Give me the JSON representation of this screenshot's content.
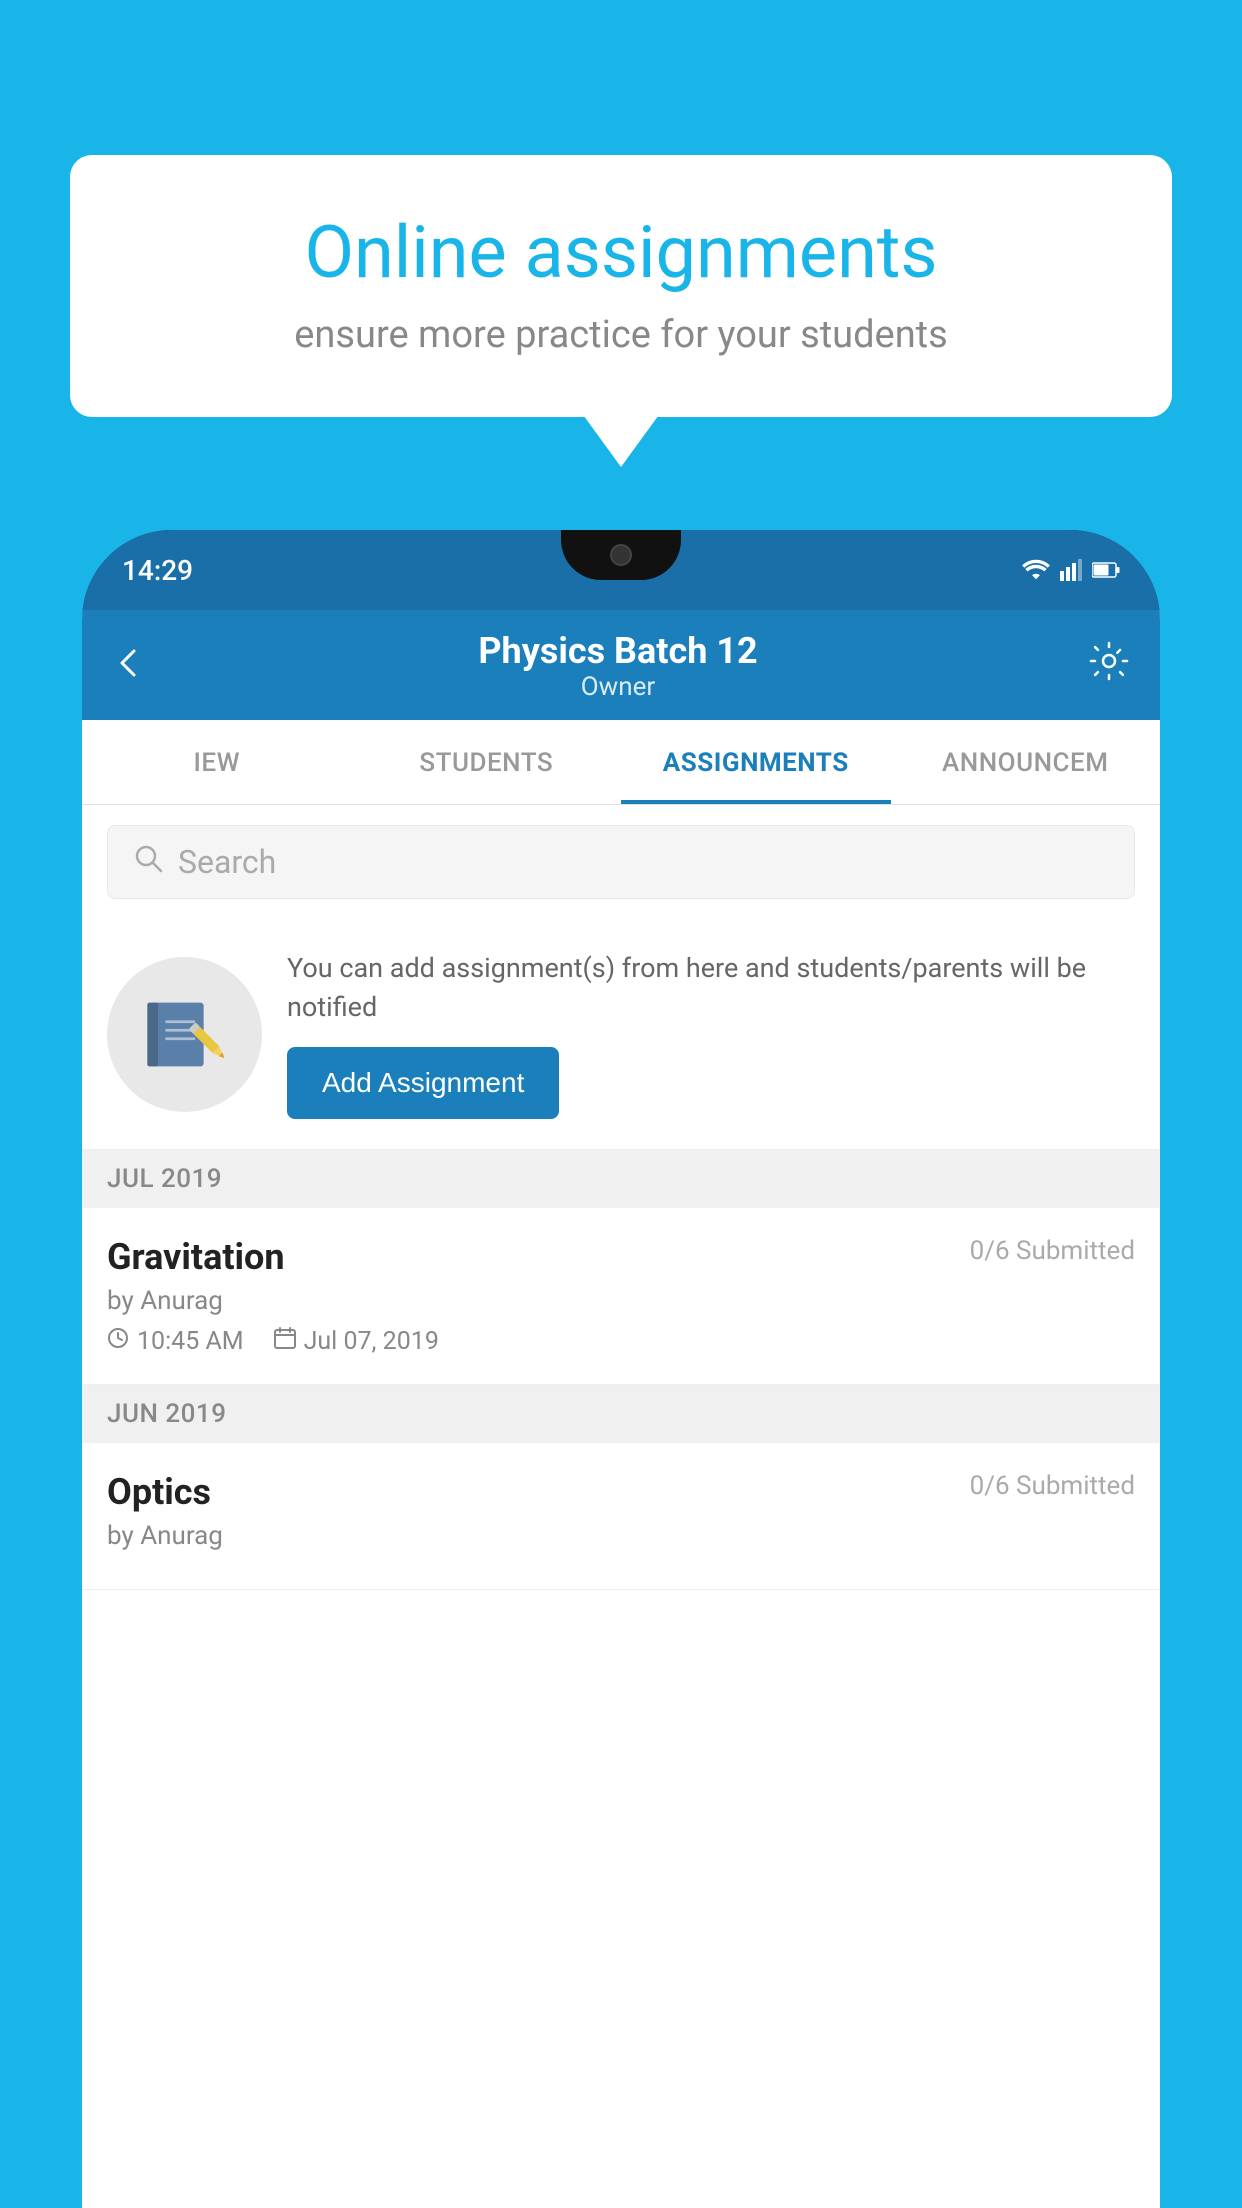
{
  "background_color": "#1ab5e8",
  "speech_bubble": {
    "title": "Online assignments",
    "subtitle": "ensure more practice for your students"
  },
  "phone": {
    "status_bar": {
      "time": "14:29"
    },
    "header": {
      "title": "Physics Batch 12",
      "subtitle": "Owner"
    },
    "tabs": [
      {
        "label": "IEW",
        "active": false
      },
      {
        "label": "STUDENTS",
        "active": false
      },
      {
        "label": "ASSIGNMENTS",
        "active": true
      },
      {
        "label": "ANNOUNCEM",
        "active": false
      }
    ],
    "search": {
      "placeholder": "Search"
    },
    "promo": {
      "description": "You can add assignment(s) from here and students/parents will be notified",
      "button_label": "Add Assignment"
    },
    "sections": [
      {
        "month": "JUL 2019",
        "assignments": [
          {
            "title": "Gravitation",
            "submitted": "0/6 Submitted",
            "author": "by Anurag",
            "time": "10:45 AM",
            "date": "Jul 07, 2019"
          }
        ]
      },
      {
        "month": "JUN 2019",
        "assignments": [
          {
            "title": "Optics",
            "submitted": "0/6 Submitted",
            "author": "by Anurag",
            "time": "",
            "date": ""
          }
        ]
      }
    ]
  }
}
